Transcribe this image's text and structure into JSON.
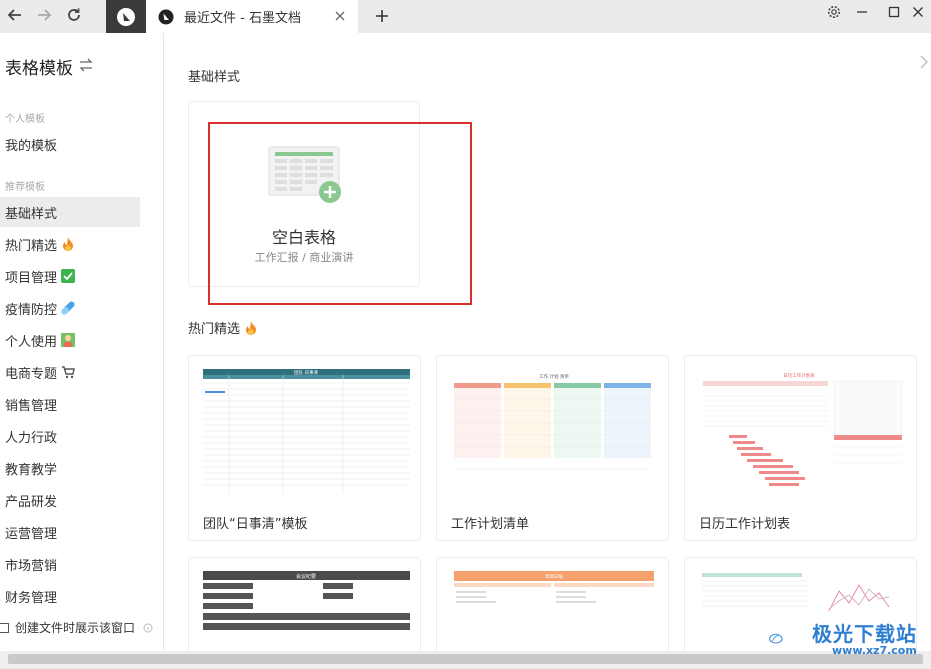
{
  "window": {
    "tab_title": "最近文件 - 石墨文档",
    "colors": {
      "titlebar": "#ebebeb",
      "accent_red": "#d9302c",
      "sheet_green": "#8cc78f"
    }
  },
  "titlebar_icons": [
    "back-arrow-icon",
    "forward-arrow-icon",
    "refresh-icon",
    "shimo-logo-icon",
    "close-icon",
    "plus-icon",
    "gear-icon",
    "minimize-icon",
    "maximize-icon",
    "close-window-icon"
  ],
  "sidebar": {
    "title": "表格模板",
    "personal_section": "个人模板",
    "my_templates": "我的模板",
    "recommended_section": "推荐模板",
    "items": [
      {
        "label": "基础样式",
        "active": true
      },
      {
        "label": "热门精选",
        "emoji": "fire-icon"
      },
      {
        "label": "项目管理",
        "emoji": "check-icon"
      },
      {
        "label": "疫情防控",
        "emoji": "pill-icon"
      },
      {
        "label": "个人使用",
        "emoji": "person-icon"
      },
      {
        "label": "电商专题",
        "emoji": "cart-icon"
      },
      {
        "label": "销售管理"
      },
      {
        "label": "人力行政"
      },
      {
        "label": "教育教学"
      },
      {
        "label": "产品研发"
      },
      {
        "label": "运营管理"
      },
      {
        "label": "市场营销"
      },
      {
        "label": "财务管理"
      }
    ],
    "show_on_create_label": "创建文件时展示该窗口"
  },
  "main": {
    "basic_section": "基础样式",
    "blank_title": "空白表格",
    "blank_sub": "工作汇报 / 商业演讲",
    "hot_section": "热门精选",
    "templates": [
      {
        "name": "团队“日事清”模板",
        "header": "团队 日事清"
      },
      {
        "name": "工作计划清单",
        "header": "工作 计划 清单"
      },
      {
        "name": "日历工作计划表",
        "header": "日历工作计划表"
      }
    ],
    "row3": [
      {
        "header": "会议纪要"
      },
      {
        "header": "项目日报"
      },
      {
        "header": ""
      }
    ]
  },
  "watermark": {
    "text": "极光下载站",
    "url": "www.xz7.com"
  }
}
